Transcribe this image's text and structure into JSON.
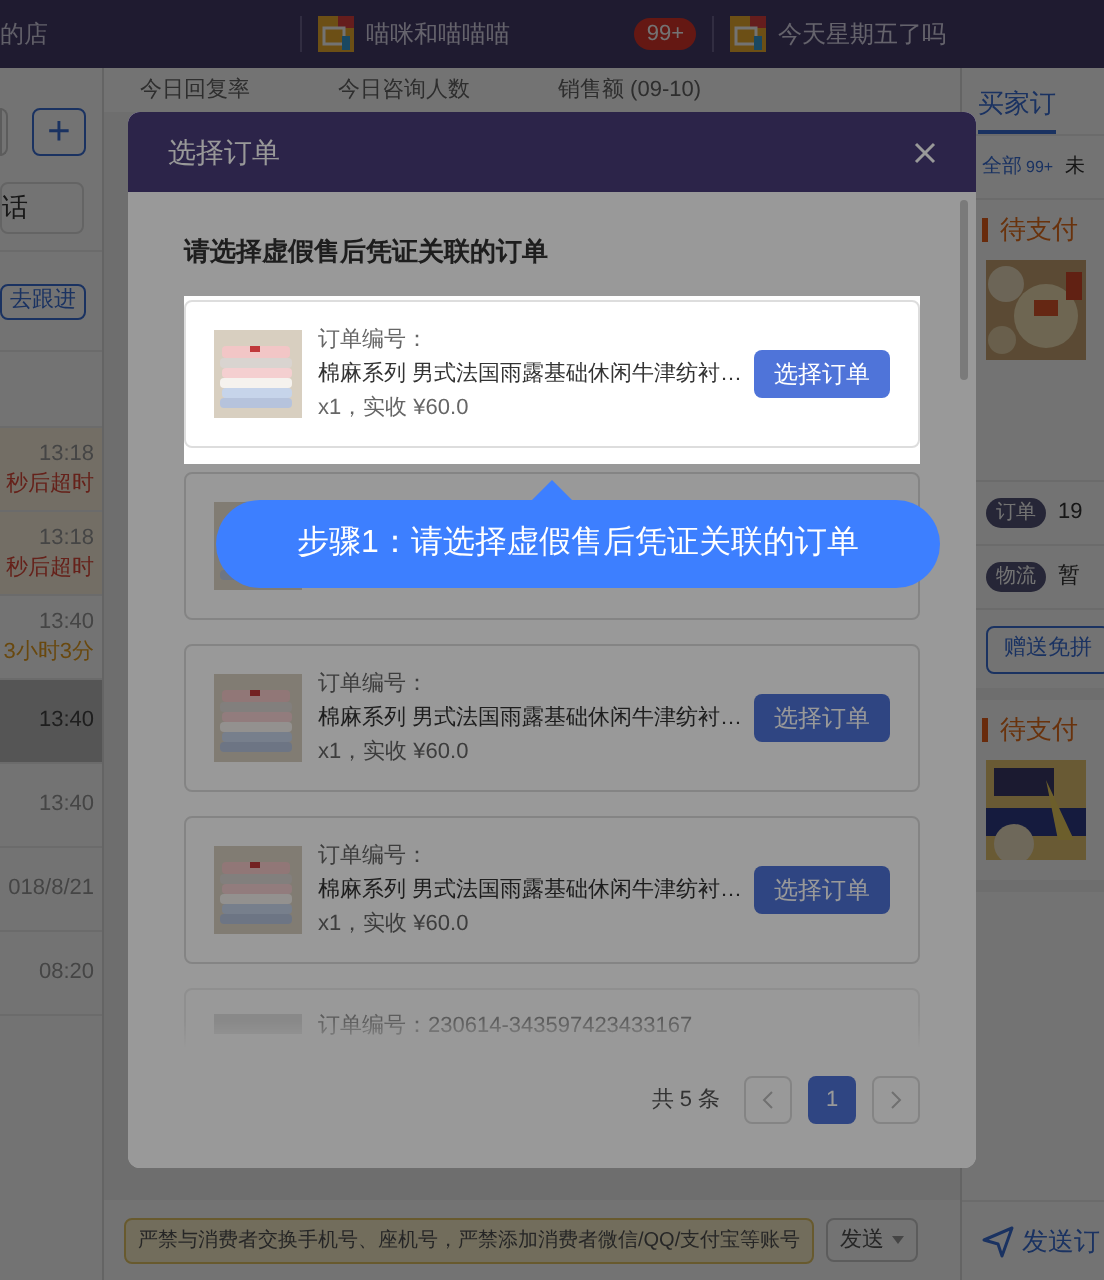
{
  "top_bar": {
    "shop_name": "的店",
    "chats": [
      {
        "name": "喵咪和喵喵喵",
        "badge": "99+"
      },
      {
        "name": "今天星期五了吗"
      }
    ]
  },
  "stats": [
    "今日回复率",
    "今日咨询人数",
    "销售额 (09-10)"
  ],
  "left_panel": {
    "add_button": "+",
    "search_hint": "话",
    "follow_button": "去跟进",
    "rows": [
      {
        "time": "13:18",
        "note": "秒后超时",
        "kind": "urgent",
        "selected": false
      },
      {
        "time": "13:18",
        "note": "秒后超时",
        "kind": "urgent",
        "selected": false
      },
      {
        "time": "13:40",
        "note": "3小时3分",
        "kind": "waiting",
        "selected": false
      },
      {
        "time": "13:40",
        "kind": "plain",
        "selected": true
      },
      {
        "time": "13:40",
        "kind": "plain",
        "selected": false
      },
      {
        "time": "018/8/21",
        "kind": "plain",
        "selected": false
      },
      {
        "time": "08:20",
        "kind": "plain",
        "selected": false
      }
    ]
  },
  "composer": {
    "warning": "严禁与消费者交换手机号、座机号，严禁添加消费者微信/QQ/支付宝等账号",
    "send_button": "发送"
  },
  "right_panel": {
    "tab": "买家订",
    "filters": [
      {
        "label": "全部",
        "count": "99+",
        "selected": true
      },
      {
        "label": "未",
        "selected": false
      }
    ],
    "orders": [
      {
        "status": "待支付",
        "tags": [
          {
            "label": "订单",
            "value": "19"
          },
          {
            "label": "物流",
            "value": "暂"
          }
        ],
        "button": "赠送免拼"
      },
      {
        "status": "待支付"
      }
    ],
    "send_order": "发送订"
  },
  "dialog": {
    "title": "选择订单",
    "subtitle": "请选择虚假售后凭证关联的订单",
    "orders": [
      {
        "kind": "highlighted",
        "number_label": "订单编号：",
        "title": "棉麻系列 男式法国雨露基础休闲牛津纺衬…",
        "price": "x1，实收 ¥60.0",
        "button": "选择订单"
      },
      {
        "kind": "covered"
      },
      {
        "kind": "normal",
        "number_label": "订单编号：",
        "title": "棉麻系列 男式法国雨露基础休闲牛津纺衬…",
        "price": "x1，实收 ¥60.0",
        "button": "选择订单"
      },
      {
        "kind": "normal",
        "number_label": "订单编号：",
        "title": "棉麻系列 男式法国雨露基础休闲牛津纺衬…",
        "price": "x1，实收 ¥60.0",
        "button": "选择订单"
      },
      {
        "kind": "faded",
        "number_label": "订单编号：230614-343597423433167"
      }
    ],
    "total": "共 5 条",
    "pages": [
      {
        "label": "1",
        "selected": true
      }
    ],
    "tooltip": "步骤1：请选择虚假售后凭证关联的订单"
  }
}
